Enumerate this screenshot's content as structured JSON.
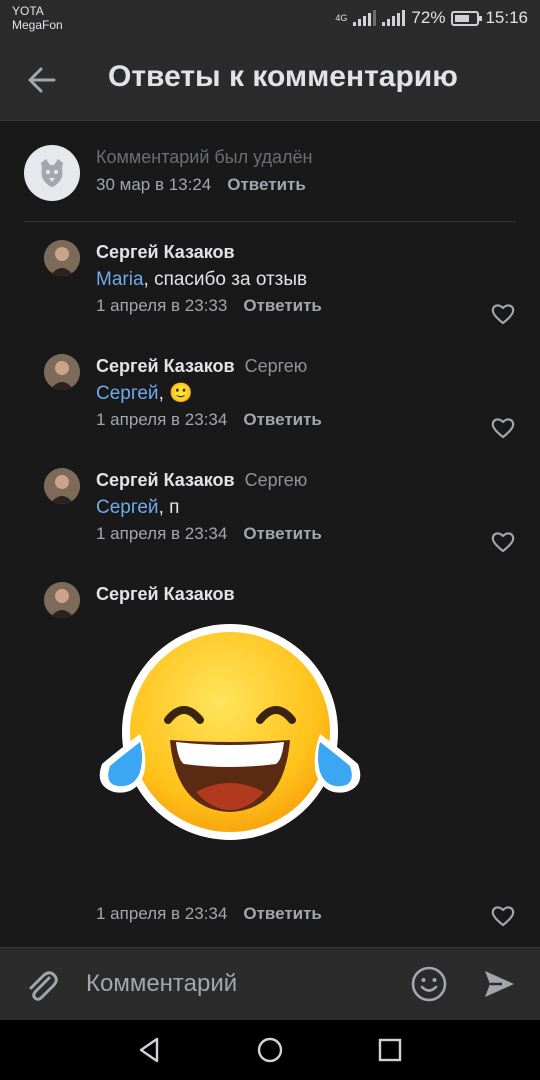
{
  "status": {
    "carrier1": "YOTA",
    "carrier2": "MegaFon",
    "network": "4G",
    "battery": "72%",
    "battery_level": 0.72,
    "time": "15:16"
  },
  "header": {
    "title": "Ответы к комментарию"
  },
  "original": {
    "text": "Комментарий был удалён",
    "date": "30 мар в 13:24",
    "reply_label": "Ответить"
  },
  "comments": [
    {
      "author": "Сергей Казаков",
      "to": "",
      "mention": "Maria",
      "text": ", спасибо за отзыв",
      "date": "1 апреля в 23:33",
      "reply_label": "Ответить"
    },
    {
      "author": "Сергей Казаков",
      "to": "Сергею",
      "mention": "Сергей",
      "text": ", 🙂",
      "date": "1 апреля в 23:34",
      "reply_label": "Ответить"
    },
    {
      "author": "Сергей Казаков",
      "to": "Сергею",
      "mention": "Сергей",
      "text": ", п",
      "date": "1 апреля в 23:34",
      "reply_label": "Ответить"
    },
    {
      "author": "Сергей Казаков",
      "to": "",
      "sticker": "laughing-tears-emoji",
      "date": "1 апреля в 23:34",
      "reply_label": "Ответить"
    }
  ],
  "composer": {
    "placeholder": "Комментарий"
  },
  "colors": {
    "background": "#19191a",
    "bar": "#2b2b2c",
    "mention": "#71aaeb",
    "secondary_text": "#a3a6ab"
  }
}
